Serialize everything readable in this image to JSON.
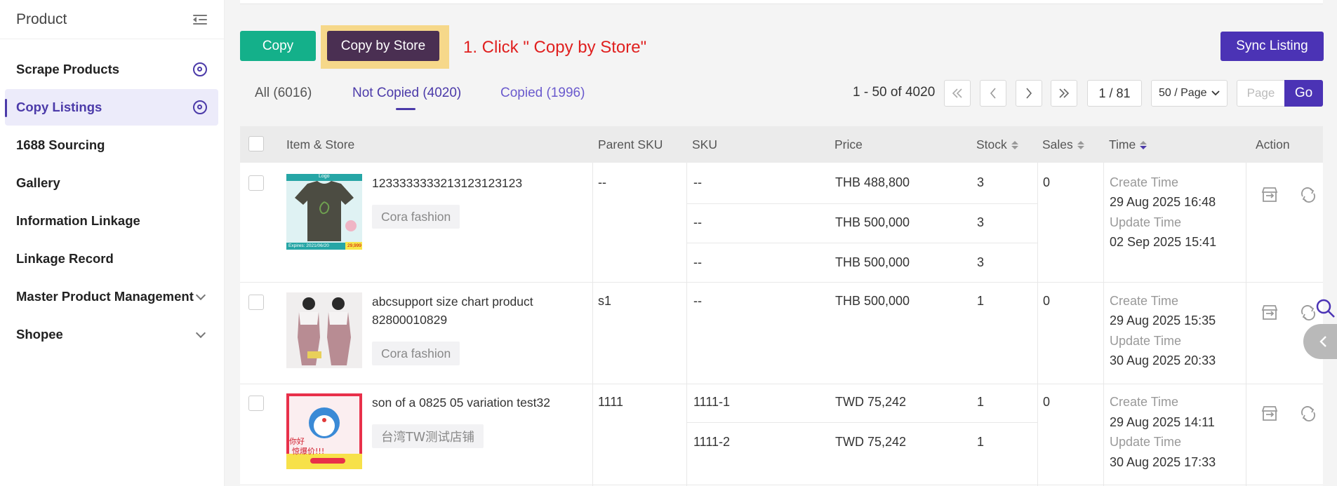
{
  "sidebar": {
    "title": "Product",
    "items": [
      {
        "label": "Scrape Products",
        "icon": "gear-icon"
      },
      {
        "label": "Copy Listings",
        "icon": "gear-icon",
        "active": true
      },
      {
        "label": "1688 Sourcing"
      },
      {
        "label": "Gallery"
      },
      {
        "label": "Information Linkage"
      },
      {
        "label": "Linkage Record"
      },
      {
        "label": "Master Product Management",
        "icon": "chevron-down-icon"
      },
      {
        "label": "Shopee",
        "icon": "chevron-down-icon"
      }
    ]
  },
  "toolbar": {
    "copy_label": "Copy",
    "copy_by_store_label": "Copy by Store",
    "annotation": "1. Click \" Copy by Store\"",
    "sync_label": "Sync Listing"
  },
  "tabs": {
    "all": "All (6016)",
    "not_copied": "Not Copied (4020)",
    "copied": "Copied (1996)"
  },
  "pagination": {
    "range": "1 - 50 of 4020",
    "page": "1 / 81",
    "per_page": "50 / Page",
    "page_placeholder": "Page",
    "go_label": "Go"
  },
  "table": {
    "headers": {
      "item": "Item & Store",
      "parent_sku": "Parent SKU",
      "sku": "SKU",
      "price": "Price",
      "stock": "Stock",
      "sales": "Sales",
      "time": "Time",
      "action": "Action"
    },
    "create_label": "Create Time",
    "update_label": "Update Time",
    "rows": [
      {
        "title": "1233333333213123123123",
        "store": "Cora fashion",
        "parent_sku": "--",
        "sales": "0",
        "create_time": "29 Aug 2025 16:48",
        "update_time": "02 Sep 2025 15:41",
        "thumb_logo": "Logo",
        "thumb_footer": "Expires: 2021/06/20",
        "thumb_price": "29,999",
        "variants": [
          {
            "sku": "--",
            "price": "THB 488,800",
            "stock": "3"
          },
          {
            "sku": "--",
            "price": "THB 500,000",
            "stock": "3"
          },
          {
            "sku": "--",
            "price": "THB 500,000",
            "stock": "3"
          }
        ]
      },
      {
        "title_line1": "abcsupport size chart product",
        "title_line2": "82800010829",
        "store": "Cora fashion",
        "parent_sku": "s1",
        "sales": "0",
        "create_time": "29 Aug 2025 15:35",
        "update_time": "30 Aug 2025 20:33",
        "variants": [
          {
            "sku": "--",
            "price": "THB 500,000",
            "stock": "1"
          }
        ]
      },
      {
        "title": "son of a 0825 05 variation test32",
        "store": "台湾TW测试店铺",
        "parent_sku": "1111",
        "sales": "0",
        "create_time": "29 Aug 2025 14:11",
        "update_time": "30 Aug 2025 17:33",
        "thumb_text1": "你好",
        "thumb_text2": "惊爆价!!!",
        "variants": [
          {
            "sku": "1111-1",
            "price": "TWD 75,242",
            "stock": "1"
          },
          {
            "sku": "1111-2",
            "price": "TWD 75,242",
            "stock": "1"
          }
        ]
      }
    ]
  },
  "colors": {
    "brand": "#4b33b5",
    "copy_button": "#14b08a",
    "copy_by_store_button": "#4a2f52",
    "highlight": "#f6d88a",
    "annotation": "#e0201f"
  }
}
